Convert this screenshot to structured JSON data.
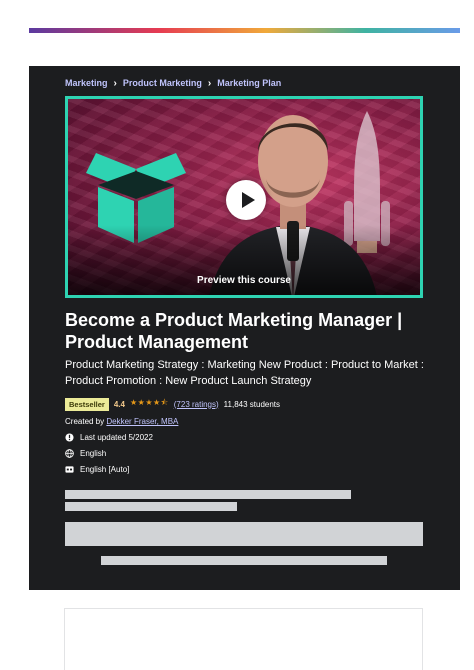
{
  "breadcrumb": [
    "Marketing",
    "Product Marketing",
    "Marketing Plan"
  ],
  "preview": {
    "label": "Preview this course"
  },
  "course": {
    "title": "Become a Product Marketing Manager | Product Management",
    "subtitle": "Product Marketing Strategy : Marketing New Product : Product to Market : Product Promotion : New Product Launch Strategy",
    "badge": "Bestseller",
    "rating": "4.4",
    "stars": "★★★★⯪",
    "ratings_count": "(723 ratings)",
    "students": "11,843 students",
    "created_prefix": "Created by",
    "instructor": "Dekker Fraser, MBA",
    "last_updated": "Last updated 5/2022",
    "language": "English",
    "captions": "English [Auto]"
  },
  "colors": {
    "card_bg": "#1c1d1f",
    "accent_link": "#c0c4fc",
    "badge_bg": "#eceb98",
    "star": "#e59819",
    "frame": "#2ed3b2"
  }
}
